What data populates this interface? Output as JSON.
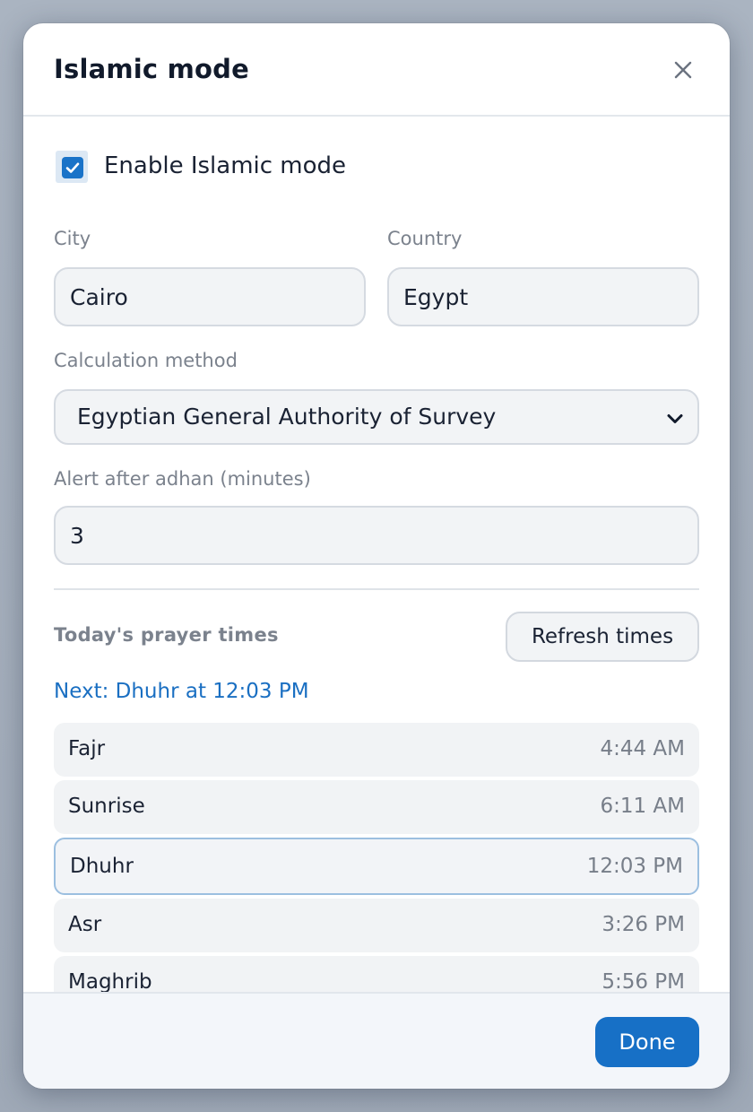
{
  "dialog": {
    "title": "Islamic mode",
    "close_icon": "close-icon"
  },
  "enable": {
    "label": "Enable Islamic mode",
    "checked": true
  },
  "location": {
    "city_label": "City",
    "city_value": "Cairo",
    "country_label": "Country",
    "country_value": "Egypt"
  },
  "calculation": {
    "label": "Calculation method",
    "selected": "Egyptian General Authority of Survey"
  },
  "alert": {
    "label": "Alert after adhan (minutes)",
    "value": "3"
  },
  "prayers": {
    "section_title": "Today's prayer times",
    "refresh_label": "Refresh times",
    "next_text": "Next: Dhuhr at 12:03 PM",
    "items": [
      {
        "name": "Fajr",
        "time": "4:44 AM"
      },
      {
        "name": "Sunrise",
        "time": "6:11 AM"
      },
      {
        "name": "Dhuhr",
        "time": "12:03 PM",
        "current": true
      },
      {
        "name": "Asr",
        "time": "3:26 PM"
      },
      {
        "name": "Maghrib",
        "time": "5:56 PM"
      }
    ]
  },
  "footer": {
    "done_label": "Done"
  },
  "colors": {
    "accent": "#1770c6",
    "highlight_border": "#9cbfe0"
  }
}
